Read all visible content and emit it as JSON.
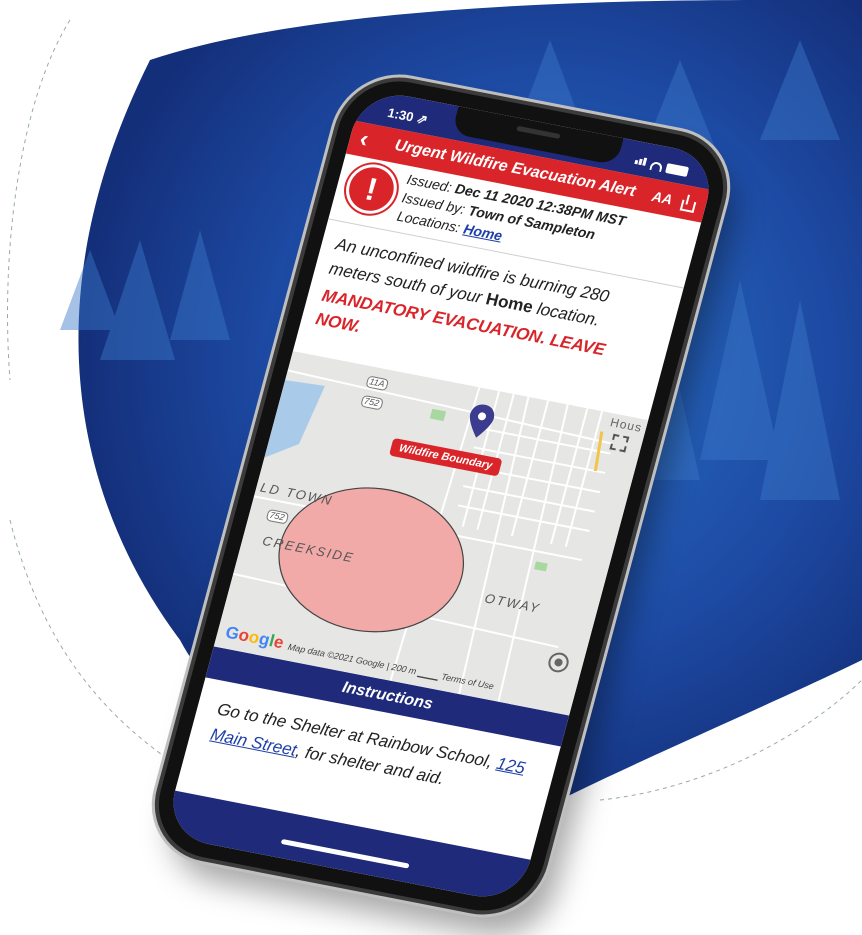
{
  "colors": {
    "navy": "#1f2a7a",
    "alert_red": "#d9252a",
    "link_blue": "#1f3fa8",
    "wildfire_fill": "#f2aaa8"
  },
  "status_bar": {
    "time": "1:30 ⇗"
  },
  "header": {
    "back_icon": "chevron-left-icon",
    "title": "Urgent Wildfire Evacuation Alert",
    "text_size_label": "AA",
    "share_icon": "share-icon"
  },
  "meta": {
    "alert_icon_glyph": "!",
    "issued_label": "Issued: ",
    "issued_value": "Dec 11 2020 12:38PM MST",
    "issued_by_label": "Issued by: ",
    "issued_by_value": "Town of Sampleton",
    "locations_label": "Locations: ",
    "locations_value": "Home"
  },
  "message": {
    "part1": "An unconfined wildfire is burning 280 meters south of your ",
    "bold_word": "Home",
    "part2": " location.",
    "mandatory": "MANDATORY EVACUATION. LEAVE NOW."
  },
  "map": {
    "wildfire_label": "Wildfire Boundary",
    "places": {
      "old_town": "LD TOWN",
      "creekside": "CREEKSIDE",
      "otway": "OTWAY",
      "hous": "Hous"
    },
    "route_shields": [
      "11A",
      "752",
      "752"
    ],
    "google_letters": [
      "G",
      "o",
      "o",
      "g",
      "l",
      "e"
    ],
    "map_data": "Map data ©2021 Google",
    "scale": "200 m",
    "terms": "Terms of Use"
  },
  "instructions": {
    "heading": "Instructions",
    "text_before": "Go to the Shelter at Rainbow School, ",
    "link": "125 Main Street",
    "text_after": ", for shelter and aid."
  }
}
